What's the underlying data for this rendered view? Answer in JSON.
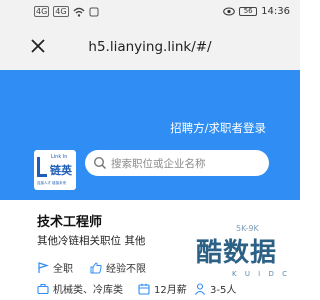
{
  "status_bar": {
    "signal_label": "4G",
    "signal2_label": "4G",
    "battery": "56",
    "time": "14:36"
  },
  "nav": {
    "url": "h5.lianying.link/#/",
    "close_icon": "close-icon"
  },
  "banner": {
    "login_link": "招聘方/求职者登录",
    "logo": {
      "en": "Link In",
      "cn": "链英",
      "tagline": "连接人才 链接未来"
    },
    "search_placeholder": "搜索职位或企业名称",
    "color": "#2f8df3"
  },
  "job_card": {
    "title": "技术工程师",
    "subtitle": "其他冷链相关职位 其他",
    "tags": [
      {
        "icon": "flag-icon",
        "label": "全职"
      },
      {
        "icon": "thumbs-up-icon",
        "label": "经验不限"
      },
      {
        "icon": "briefcase-icon",
        "label": "机械类、冷库类"
      },
      {
        "icon": "calendar-icon",
        "label": "12月薪"
      },
      {
        "icon": "person-icon",
        "label": "3-5人"
      }
    ]
  },
  "watermark": {
    "text": "酷数据",
    "subtext": "K U I D C",
    "badge": "5K-9K"
  }
}
